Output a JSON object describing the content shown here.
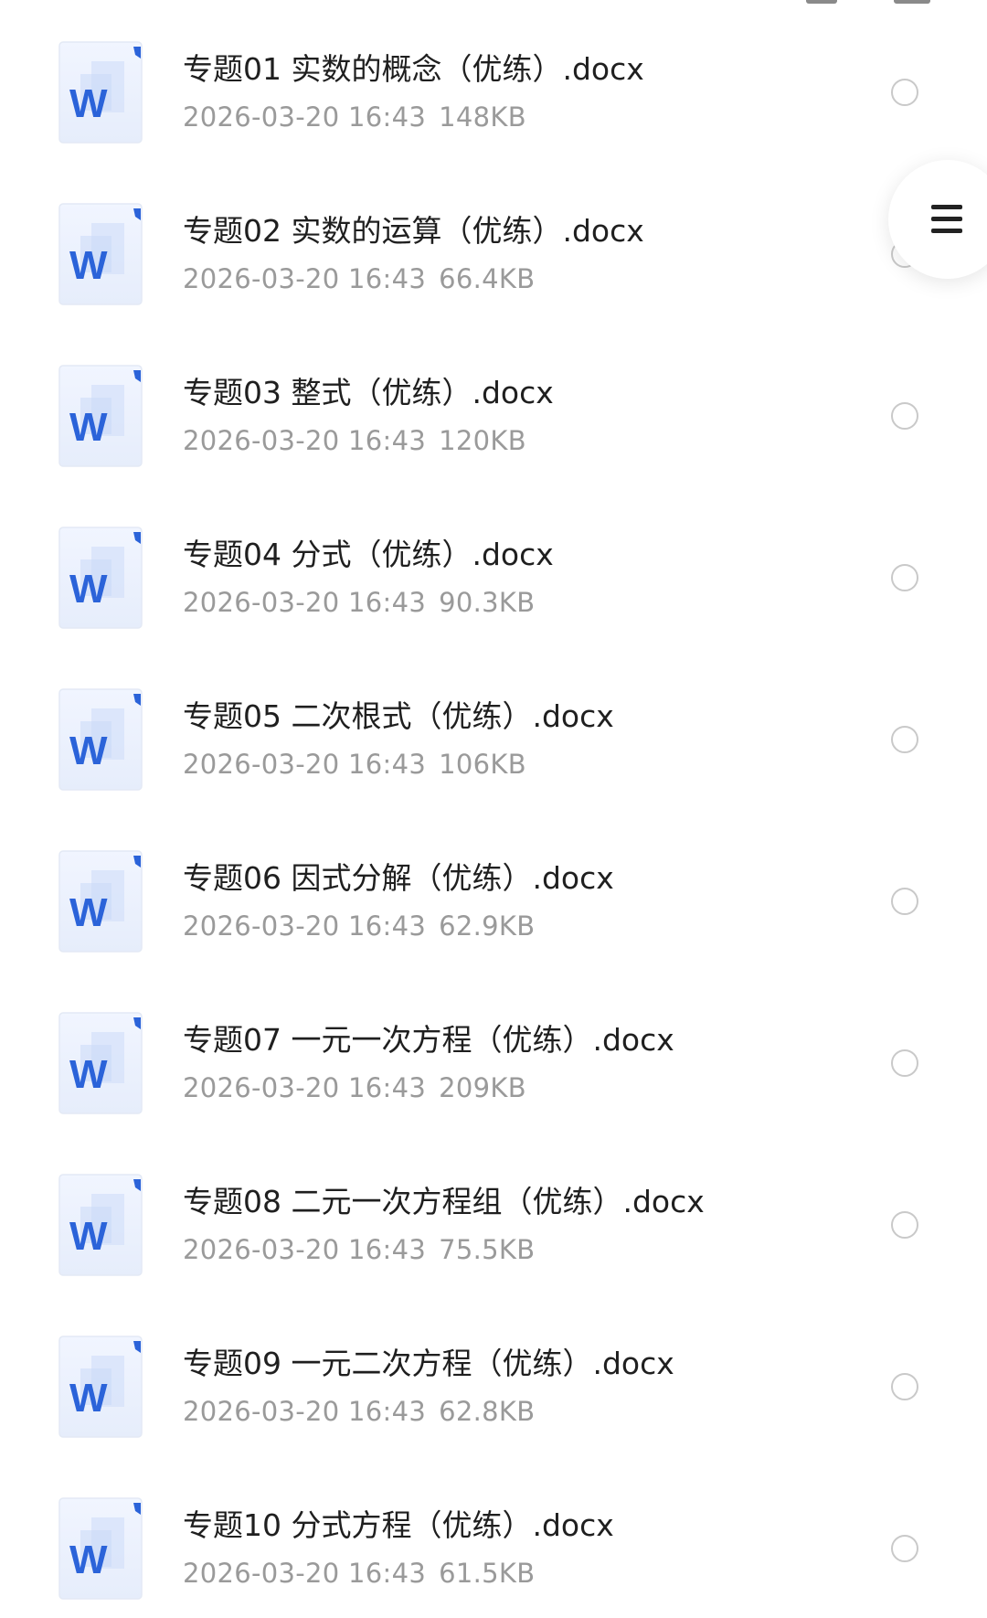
{
  "files": [
    {
      "name": "专题01 实数的概念（优练）.docx",
      "date": "2026-03-20 16:43",
      "size": "148KB",
      "selected": false
    },
    {
      "name": "专题02 实数的运算（优练）.docx",
      "date": "2026-03-20 16:43",
      "size": "66.4KB",
      "selected": false
    },
    {
      "name": "专题03 整式（优练）.docx",
      "date": "2026-03-20 16:43",
      "size": "120KB",
      "selected": false
    },
    {
      "name": "专题04 分式（优练）.docx",
      "date": "2026-03-20 16:43",
      "size": "90.3KB",
      "selected": false
    },
    {
      "name": "专题05 二次根式（优练）.docx",
      "date": "2026-03-20 16:43",
      "size": "106KB",
      "selected": false
    },
    {
      "name": "专题06 因式分解（优练）.docx",
      "date": "2026-03-20 16:43",
      "size": "62.9KB",
      "selected": false
    },
    {
      "name": "专题07 一元一次方程（优练）.docx",
      "date": "2026-03-20 16:43",
      "size": "209KB",
      "selected": false
    },
    {
      "name": "专题08 二元一次方程组（优练）.docx",
      "date": "2026-03-20 16:43",
      "size": "75.5KB",
      "selected": false
    },
    {
      "name": "专题09 一元二次方程（优练）.docx",
      "date": "2026-03-20 16:43",
      "size": "62.8KB",
      "selected": false
    },
    {
      "name": "专题10 分式方程（优练）.docx",
      "date": "2026-03-20 16:43",
      "size": "61.5KB",
      "selected": false
    }
  ],
  "file_icon": "word-document-icon",
  "icon_letter": "W",
  "floating_button_icon": "menu-icon",
  "colors": {
    "word_blue": "#2b63d9",
    "title_text": "#1f1f1f",
    "meta_text": "#9a9a9a",
    "radio_border": "#c9c9c9"
  }
}
